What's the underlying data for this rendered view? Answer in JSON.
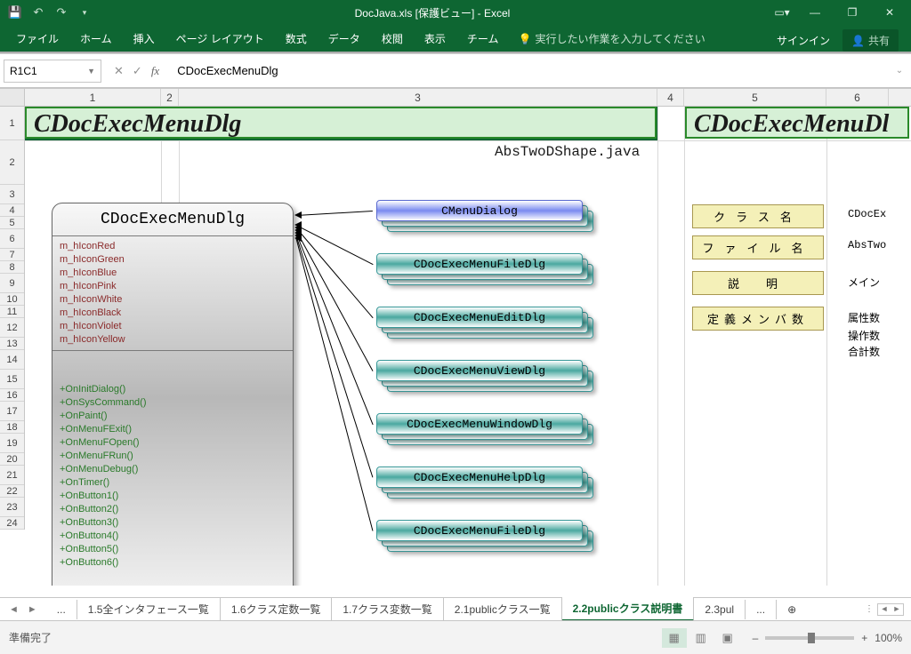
{
  "title": "DocJava.xls  [保護ビュー] - Excel",
  "qat": {
    "save": "💾",
    "undo": "↶",
    "redo": "↷",
    "dd": "▾"
  },
  "ribbon": {
    "tabs": [
      "ファイル",
      "ホーム",
      "挿入",
      "ページ レイアウト",
      "数式",
      "データ",
      "校閲",
      "表示",
      "チーム"
    ],
    "tellme_icon": "💡",
    "tellme": "実行したい作業を入力してください",
    "signin": "サインイン",
    "share_icon": "👤",
    "share": "共有"
  },
  "win": {
    "opts": "▭▾",
    "min": "―",
    "restore": "❐",
    "close": "✕"
  },
  "formula": {
    "namebox": "R1C1",
    "cancel": "✕",
    "confirm": "✓",
    "fx": "fx",
    "value": "CDocExecMenuDlg"
  },
  "cols": {
    "c1": "1",
    "c2": "2",
    "c3": "3",
    "c4": "4",
    "c5": "5",
    "c6": "6"
  },
  "content": {
    "big_title_1": "CDocExecMenuDlg",
    "big_title_2": "CDocExecMenuDl",
    "java_file": "AbsTwoDShape.java",
    "class_title": "CDocExecMenuDlg",
    "attrs": [
      "m_hIconRed",
      "m_hIconGreen",
      "m_hIconBlue",
      "m_hIconPink",
      "m_hIconWhite",
      "m_hIconBlack",
      "m_hIconViolet",
      "m_hIconYellow"
    ],
    "methods": [
      "+OnInitDialog()",
      "+OnSysCommand()",
      "+OnPaint()",
      "+OnMenuFExit()",
      "+OnMenuFOpen()",
      "+OnMenuFRun()",
      "+OnMenuDebug()",
      "+OnTimer()",
      "+OnButton1()",
      "+OnButton2()",
      "+OnButton3()",
      "+OnButton4()",
      "+OnButton5()",
      "+OnButton6()"
    ],
    "related": [
      "CMenuDialog",
      "CDocExecMenuFileDlg",
      "CDocExecMenuEditDlg",
      "CDocExecMenuViewDlg",
      "CDocExecMenuWindowDlg",
      "CDocExecMenuHelpDlg",
      "CDocExecMenuFileDlg"
    ],
    "labels": [
      "クラス名",
      "ファイル名",
      "説明",
      "定義メンバ数"
    ],
    "side": [
      "CDocEx",
      "AbsTwo",
      "メイン",
      "属性数",
      "操作数",
      "合計数"
    ]
  },
  "tabs": {
    "more": "...",
    "list": [
      "1.5全インタフェース一覧",
      "1.6クラス定数一覧",
      "1.7クラス変数一覧",
      "2.1publicクラス一覧",
      "2.2publicクラス説明書",
      "2.3pul"
    ],
    "active": 4,
    "more2": "...",
    "plus": "⊕"
  },
  "status": {
    "ready": "準備完了",
    "zoom": "100%",
    "minus": "–",
    "plus": "+"
  }
}
